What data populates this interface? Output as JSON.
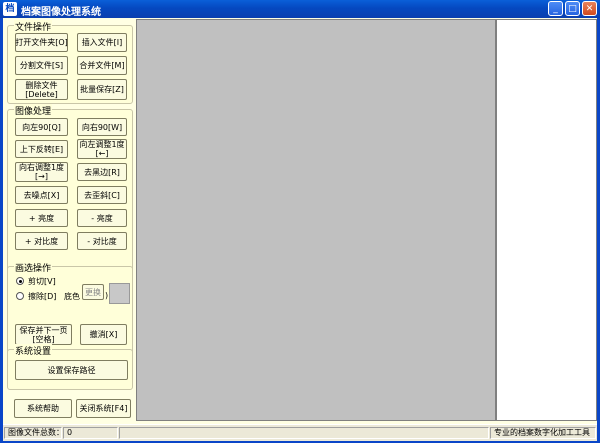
{
  "window": {
    "title": "档案图像处理系统",
    "icon": "app-icon"
  },
  "file_ops": {
    "legend": "文件操作",
    "open_folder": "打开文件夹[O]",
    "insert_file": "插入文件[I]",
    "split_file": "分割文件[S]",
    "merge_file": "合并文件[M]",
    "delete_file": "删除文件\n[Delete]",
    "batch_save": "批量保存[Z]"
  },
  "image_ops": {
    "legend": "图像处理",
    "rotate_left": "向左90[Q]",
    "rotate_right": "向右90[W]",
    "flip": "上下反转[E]",
    "adjust_left": "向左调整1度\n[←]",
    "adjust_right": "向右调整1度\n[→]",
    "remove_black": "去黑边[R]",
    "denoise": "去噪点[X]",
    "deskew": "去歪斜[C]",
    "brightness_up": "+ 亮度",
    "brightness_down": "- 亮度",
    "contrast_up": "+ 对比度",
    "contrast_down": "- 对比度"
  },
  "select_ops": {
    "legend": "画选操作",
    "crop": "剪切[V]",
    "erase": "擦除[D]",
    "bg_color_label": "底色",
    "change_button": "更换",
    "save_next": "保存并下一页\n[空格]",
    "undo": "撤消[X]"
  },
  "settings": {
    "legend": "系统设置",
    "set_path": "设置保存路径"
  },
  "bottom": {
    "help": "系统帮助",
    "close": "关闭系统[F4]"
  },
  "status": {
    "count_label": "图像文件总数：",
    "count_value": "0",
    "tagline": "专业的档案数字化加工工具"
  },
  "colors": {
    "titlebar": "#0548C0",
    "panel_bg": "#FFFFD9",
    "canvas": "#C0C0C0",
    "bg_swatch": "#C8C8C8"
  }
}
